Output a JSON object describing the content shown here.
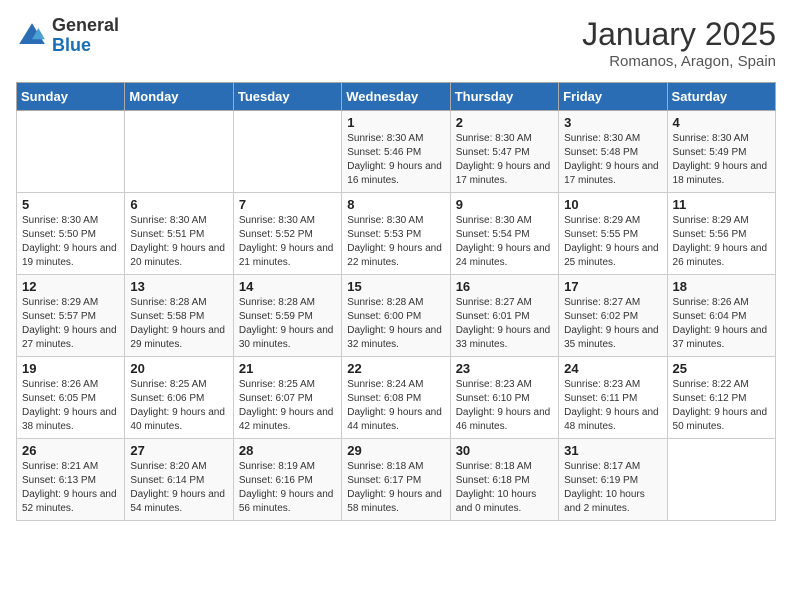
{
  "header": {
    "logo_general": "General",
    "logo_blue": "Blue",
    "title": "January 2025",
    "subtitle": "Romanos, Aragon, Spain"
  },
  "days_of_week": [
    "Sunday",
    "Monday",
    "Tuesday",
    "Wednesday",
    "Thursday",
    "Friday",
    "Saturday"
  ],
  "weeks": [
    [
      {
        "day": "",
        "sunrise": "",
        "sunset": "",
        "daylight": ""
      },
      {
        "day": "",
        "sunrise": "",
        "sunset": "",
        "daylight": ""
      },
      {
        "day": "",
        "sunrise": "",
        "sunset": "",
        "daylight": ""
      },
      {
        "day": "1",
        "sunrise": "Sunrise: 8:30 AM",
        "sunset": "Sunset: 5:46 PM",
        "daylight": "Daylight: 9 hours and 16 minutes."
      },
      {
        "day": "2",
        "sunrise": "Sunrise: 8:30 AM",
        "sunset": "Sunset: 5:47 PM",
        "daylight": "Daylight: 9 hours and 17 minutes."
      },
      {
        "day": "3",
        "sunrise": "Sunrise: 8:30 AM",
        "sunset": "Sunset: 5:48 PM",
        "daylight": "Daylight: 9 hours and 17 minutes."
      },
      {
        "day": "4",
        "sunrise": "Sunrise: 8:30 AM",
        "sunset": "Sunset: 5:49 PM",
        "daylight": "Daylight: 9 hours and 18 minutes."
      }
    ],
    [
      {
        "day": "5",
        "sunrise": "Sunrise: 8:30 AM",
        "sunset": "Sunset: 5:50 PM",
        "daylight": "Daylight: 9 hours and 19 minutes."
      },
      {
        "day": "6",
        "sunrise": "Sunrise: 8:30 AM",
        "sunset": "Sunset: 5:51 PM",
        "daylight": "Daylight: 9 hours and 20 minutes."
      },
      {
        "day": "7",
        "sunrise": "Sunrise: 8:30 AM",
        "sunset": "Sunset: 5:52 PM",
        "daylight": "Daylight: 9 hours and 21 minutes."
      },
      {
        "day": "8",
        "sunrise": "Sunrise: 8:30 AM",
        "sunset": "Sunset: 5:53 PM",
        "daylight": "Daylight: 9 hours and 22 minutes."
      },
      {
        "day": "9",
        "sunrise": "Sunrise: 8:30 AM",
        "sunset": "Sunset: 5:54 PM",
        "daylight": "Daylight: 9 hours and 24 minutes."
      },
      {
        "day": "10",
        "sunrise": "Sunrise: 8:29 AM",
        "sunset": "Sunset: 5:55 PM",
        "daylight": "Daylight: 9 hours and 25 minutes."
      },
      {
        "day": "11",
        "sunrise": "Sunrise: 8:29 AM",
        "sunset": "Sunset: 5:56 PM",
        "daylight": "Daylight: 9 hours and 26 minutes."
      }
    ],
    [
      {
        "day": "12",
        "sunrise": "Sunrise: 8:29 AM",
        "sunset": "Sunset: 5:57 PM",
        "daylight": "Daylight: 9 hours and 27 minutes."
      },
      {
        "day": "13",
        "sunrise": "Sunrise: 8:28 AM",
        "sunset": "Sunset: 5:58 PM",
        "daylight": "Daylight: 9 hours and 29 minutes."
      },
      {
        "day": "14",
        "sunrise": "Sunrise: 8:28 AM",
        "sunset": "Sunset: 5:59 PM",
        "daylight": "Daylight: 9 hours and 30 minutes."
      },
      {
        "day": "15",
        "sunrise": "Sunrise: 8:28 AM",
        "sunset": "Sunset: 6:00 PM",
        "daylight": "Daylight: 9 hours and 32 minutes."
      },
      {
        "day": "16",
        "sunrise": "Sunrise: 8:27 AM",
        "sunset": "Sunset: 6:01 PM",
        "daylight": "Daylight: 9 hours and 33 minutes."
      },
      {
        "day": "17",
        "sunrise": "Sunrise: 8:27 AM",
        "sunset": "Sunset: 6:02 PM",
        "daylight": "Daylight: 9 hours and 35 minutes."
      },
      {
        "day": "18",
        "sunrise": "Sunrise: 8:26 AM",
        "sunset": "Sunset: 6:04 PM",
        "daylight": "Daylight: 9 hours and 37 minutes."
      }
    ],
    [
      {
        "day": "19",
        "sunrise": "Sunrise: 8:26 AM",
        "sunset": "Sunset: 6:05 PM",
        "daylight": "Daylight: 9 hours and 38 minutes."
      },
      {
        "day": "20",
        "sunrise": "Sunrise: 8:25 AM",
        "sunset": "Sunset: 6:06 PM",
        "daylight": "Daylight: 9 hours and 40 minutes."
      },
      {
        "day": "21",
        "sunrise": "Sunrise: 8:25 AM",
        "sunset": "Sunset: 6:07 PM",
        "daylight": "Daylight: 9 hours and 42 minutes."
      },
      {
        "day": "22",
        "sunrise": "Sunrise: 8:24 AM",
        "sunset": "Sunset: 6:08 PM",
        "daylight": "Daylight: 9 hours and 44 minutes."
      },
      {
        "day": "23",
        "sunrise": "Sunrise: 8:23 AM",
        "sunset": "Sunset: 6:10 PM",
        "daylight": "Daylight: 9 hours and 46 minutes."
      },
      {
        "day": "24",
        "sunrise": "Sunrise: 8:23 AM",
        "sunset": "Sunset: 6:11 PM",
        "daylight": "Daylight: 9 hours and 48 minutes."
      },
      {
        "day": "25",
        "sunrise": "Sunrise: 8:22 AM",
        "sunset": "Sunset: 6:12 PM",
        "daylight": "Daylight: 9 hours and 50 minutes."
      }
    ],
    [
      {
        "day": "26",
        "sunrise": "Sunrise: 8:21 AM",
        "sunset": "Sunset: 6:13 PM",
        "daylight": "Daylight: 9 hours and 52 minutes."
      },
      {
        "day": "27",
        "sunrise": "Sunrise: 8:20 AM",
        "sunset": "Sunset: 6:14 PM",
        "daylight": "Daylight: 9 hours and 54 minutes."
      },
      {
        "day": "28",
        "sunrise": "Sunrise: 8:19 AM",
        "sunset": "Sunset: 6:16 PM",
        "daylight": "Daylight: 9 hours and 56 minutes."
      },
      {
        "day": "29",
        "sunrise": "Sunrise: 8:18 AM",
        "sunset": "Sunset: 6:17 PM",
        "daylight": "Daylight: 9 hours and 58 minutes."
      },
      {
        "day": "30",
        "sunrise": "Sunrise: 8:18 AM",
        "sunset": "Sunset: 6:18 PM",
        "daylight": "Daylight: 10 hours and 0 minutes."
      },
      {
        "day": "31",
        "sunrise": "Sunrise: 8:17 AM",
        "sunset": "Sunset: 6:19 PM",
        "daylight": "Daylight: 10 hours and 2 minutes."
      },
      {
        "day": "",
        "sunrise": "",
        "sunset": "",
        "daylight": ""
      }
    ]
  ]
}
